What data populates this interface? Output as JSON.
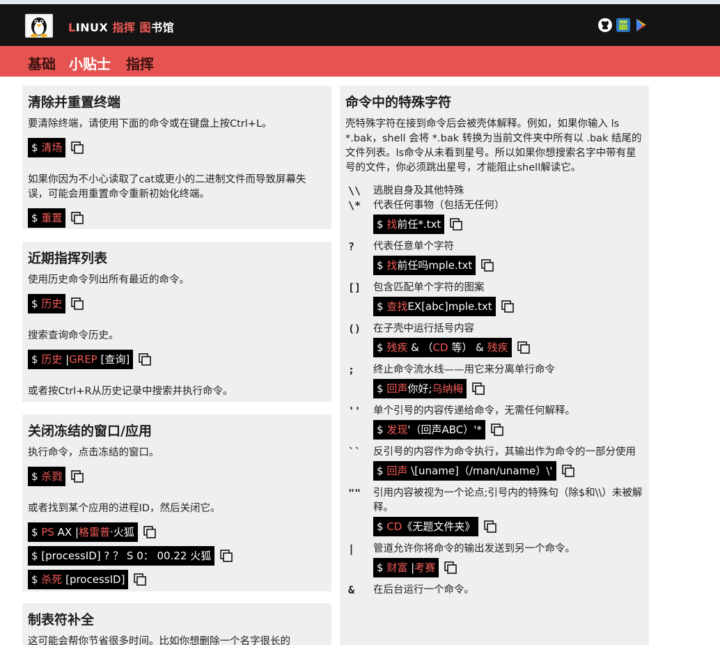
{
  "header": {
    "title_parts": [
      "L",
      "INUX ",
      "指挥",
      " ",
      "图",
      "书馆"
    ],
    "icons": [
      "github-icon",
      "android-icon",
      "play-store-icon"
    ]
  },
  "nav": {
    "items": [
      "基础",
      "小贴士",
      "指挥"
    ]
  },
  "left": {
    "card1": {
      "title": "清除并重置终端",
      "p1": "要清除终端，请使用下面的命令或在键盘上按Ctrl+L。",
      "cmd1": "清场",
      "p2": "如果你因为不小心读取了cat或更小的二进制文件而导致屏幕失误，可能会用重置命令重新初始化终端。",
      "cmd2": "重置"
    },
    "card2": {
      "title": "近期指挥列表",
      "p1": "使用历史命令列出所有最近的命令。",
      "cmd1": "历史",
      "p2": "搜索查询命令历史。",
      "cmd2_a": "历史",
      "cmd2_b": " |",
      "cmd2_c": "GREP",
      "cmd2_d": " [查询]",
      "p3": "或者按Ctrl+R从历史记录中搜索并执行命令。"
    },
    "card3": {
      "title": "关闭冻结的窗口/应用",
      "p1": "执行命令，点击冻结的窗口。",
      "cmd1": "杀戮",
      "p2": "或者找到某个应用的进程ID，然后关闭它。",
      "cmd2_a": "PS",
      "cmd2_b": " AX |",
      "cmd2_c": "格雷普",
      "cmd2_d": "·火狐",
      "cmd3": "[processID] ? ？ S 0： 00.22 火狐",
      "cmd4_a": "杀死",
      "cmd4_b": " [processID]"
    },
    "card4": {
      "title": "制表符补全",
      "p1": "这可能会帮你节省很多时间。比如你想删除一个名字很长的"
    }
  },
  "right": {
    "title": "命令中的特殊字符",
    "intro": "壳特殊字符在接到命令后会被壳体解释。例如，如果你输入 ls *.bak，shell 会将 *.bak 转换为当前文件夹中所有以 .bak 结尾的文件列表。ls命令从未看到星号。所以如果你想搜索名字中带有星号的文件，你必须跳出星号，才能阻止shell解读它。",
    "rows": [
      {
        "sym": "\\\\",
        "desc": "逃脱自身及其他特殊",
        "cmd_red": "",
        "cmd_white": ""
      },
      {
        "sym": "\\*",
        "desc": "代表任何事物（包括无任何）",
        "cmd_red": "找",
        "cmd_white": "前任*.txt"
      },
      {
        "sym": "?",
        "desc": "代表任意单个字符",
        "cmd_red": "找",
        "cmd_white": "前任吗mple.txt"
      },
      {
        "sym": "[]",
        "desc": "包含匹配单个字符的图案",
        "cmd_red": "查找",
        "cmd_white": "EX[abc]mple.txt"
      },
      {
        "sym": "()",
        "desc": "在子壳中运行括号内容",
        "cmd_red": "残疾",
        "cmd_white": " &  （",
        "cmd_red2": "CD",
        "cmd_white2": " 等） & ",
        "cmd_red3": "残疾"
      },
      {
        "sym": ";",
        "desc": "终止命令流水线——用它来分离单行命令",
        "cmd_red": "回声",
        "cmd_white": "你好;",
        "cmd_red2": "乌纳梅"
      },
      {
        "sym": "''",
        "desc": "单个引号的内容传递给命令，无需任何解释。",
        "cmd_red": "发现",
        "cmd_white": "'（回声ABC）'*"
      },
      {
        "sym": "``",
        "desc": "反引号的内容作为命令执行，其输出作为命令的一部分使用",
        "cmd_red": "回声",
        "cmd_white": " \\[uname]（/man/uname）\\'"
      },
      {
        "sym": "\"\"",
        "desc": "引用内容被视为一个论点;引号内的特殊句（除$和\\\\）未被解释。",
        "cmd_red": "CD",
        "cmd_white": "《无题文件夹》"
      },
      {
        "sym": "|",
        "desc": "管道允许你将命令的输出发送到另一个命令。",
        "cmd_red": "财富",
        "cmd_white": " |",
        "cmd_red2": "考赛"
      },
      {
        "sym": "&",
        "desc": "在后台运行一个命令。",
        "cmd_red": "",
        "cmd_white": ""
      }
    ]
  },
  "prompt": "$ "
}
